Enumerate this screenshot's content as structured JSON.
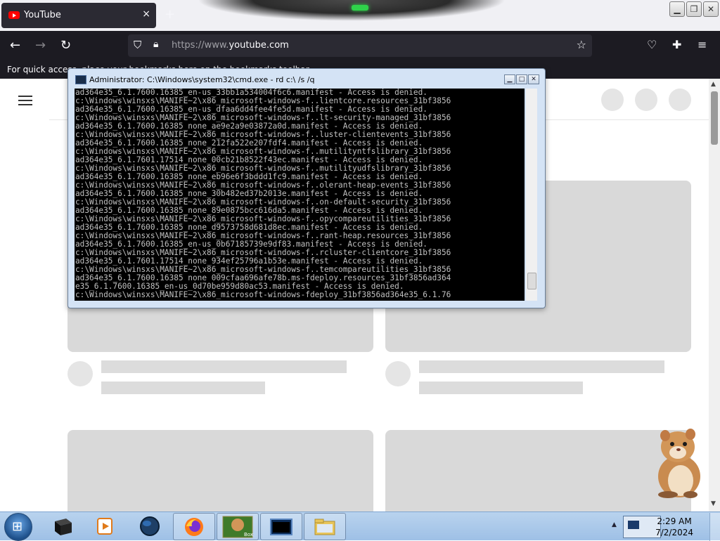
{
  "browser": {
    "tab_title": "YouTube",
    "tab_close": "×",
    "new_tab": "+",
    "url_protocol": "https://www.",
    "url_domain": "youtube.com",
    "bookmarks_text": "For quick access, place your bookmarks here on the bookmarks toolbar."
  },
  "cmd": {
    "title": "Administrator: C:\\Windows\\system32\\cmd.exe - rd  c:\\ /s /q",
    "lines": [
      "ad364e35_6.1.7600.16385_en-us_33bb1a534004f6c6.manifest - Access is denied.",
      "c:\\Windows\\winsxs\\MANIFE~2\\x86_microsoft-windows-f..lientcore.resources_31bf3856",
      "ad364e35_6.1.7600.16385_en-us_dfaa6dd4fee4fe5d.manifest - Access is denied.",
      "c:\\Windows\\winsxs\\MANIFE~2\\x86_microsoft-windows-f..lt-security-managed_31bf3856",
      "ad364e35_6.1.7600.16385_none_ae9e2a9e03872a0d.manifest - Access is denied.",
      "c:\\Windows\\winsxs\\MANIFE~2\\x86_microsoft-windows-f..luster-clientevents_31bf3856",
      "ad364e35_6.1.7600.16385_none_212fa522e207fdf4.manifest - Access is denied.",
      "c:\\Windows\\winsxs\\MANIFE~2\\x86_microsoft-windows-f..mutilityntfslibrary_31bf3856",
      "ad364e35_6.1.7601.17514_none_00cb21b8522f43ec.manifest - Access is denied.",
      "c:\\Windows\\winsxs\\MANIFE~2\\x86_microsoft-windows-f..mutilityudfslibrary_31bf3856",
      "ad364e35_6.1.7600.16385_none_eb96e6f3bddd1fc9.manifest - Access is denied.",
      "c:\\Windows\\winsxs\\MANIFE~2\\x86_microsoft-windows-f..olerant-heap-events_31bf3856",
      "ad364e35_6.1.7600.16385_none_30b482ed37b2013e.manifest - Access is denied.",
      "c:\\Windows\\winsxs\\MANIFE~2\\x86_microsoft-windows-f..on-default-security_31bf3856",
      "ad364e35_6.1.7600.16385_none_89e0875bcc616da5.manifest - Access is denied.",
      "c:\\Windows\\winsxs\\MANIFE~2\\x86_microsoft-windows-f..opycompareutilities_31bf3856",
      "ad364e35_6.1.7600.16385_none_d9573758d681d8ec.manifest - Access is denied.",
      "c:\\Windows\\winsxs\\MANIFE~2\\x86_microsoft-windows-f..rant-heap.resources_31bf3856",
      "ad364e35_6.1.7600.16385_en-us_0b67185739e9df83.manifest - Access is denied.",
      "c:\\Windows\\winsxs\\MANIFE~2\\x86_microsoft-windows-f..rcluster-clientcore_31bf3856",
      "ad364e35_6.1.7601.17514_none_934ef25796a1b53e.manifest - Access is denied.",
      "c:\\Windows\\winsxs\\MANIFE~2\\x86_microsoft-windows-f..temcompareutilities_31bf3856",
      "ad364e35_6.1.7600.16385 none 009cfaa696afe78b.ms-fdeploy.resources_31bf3856ad364",
      "e35_6.1.7600.16385_en-us_0d70be959d80ac53.manifest - Access is denied.",
      "c:\\Windows\\winsxs\\MANIFE~2\\x86_microsoft-windows-fdeploy_31bf3856ad364e35_6.1.76"
    ]
  },
  "taskbar": {
    "time": "2:29 AM",
    "date": "7/2/2024"
  }
}
